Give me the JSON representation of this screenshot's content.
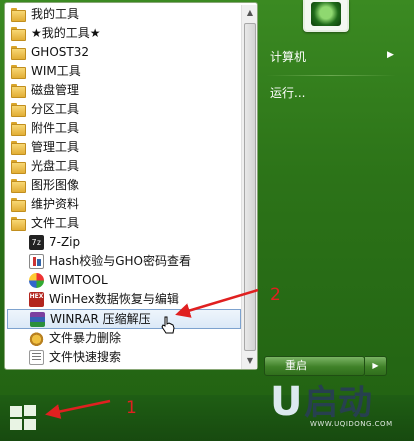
{
  "programs": {
    "folders": [
      {
        "label": "我的工具"
      },
      {
        "label": "★我的工具★"
      },
      {
        "label": "GHOST32"
      },
      {
        "label": "WIM工具"
      },
      {
        "label": "磁盘管理"
      },
      {
        "label": "分区工具"
      },
      {
        "label": "附件工具"
      },
      {
        "label": "管理工具"
      },
      {
        "label": "光盘工具"
      },
      {
        "label": "图形图像"
      },
      {
        "label": "维护资料"
      },
      {
        "label": "文件工具"
      }
    ],
    "apps": [
      {
        "label": "7-Zip",
        "icon": "7zip-icon"
      },
      {
        "label": "Hash校验与GHO密码查看",
        "icon": "hash-icon"
      },
      {
        "label": "WIMTOOL",
        "icon": "wimtool-icon"
      },
      {
        "label": "WinHex数据恢复与编辑",
        "icon": "winhex-icon"
      },
      {
        "label": "WINRAR 压缩解压",
        "icon": "winrar-icon",
        "selected": true
      },
      {
        "label": "文件暴力删除",
        "icon": "file-delete-icon"
      },
      {
        "label": "文件快速搜索",
        "icon": "file-search-icon"
      }
    ]
  },
  "right_panel": {
    "computer_label": "计算机",
    "run_label": "运行...",
    "restart_label": "重启"
  },
  "annotations": {
    "num1": "1",
    "num2": "2",
    "color": "#e02020"
  },
  "watermark": {
    "brand": "启动",
    "url": "WWW.UQIDONG.COM"
  },
  "colors": {
    "menu_green": "#2c7318",
    "selection_border": "#7da2ce"
  }
}
